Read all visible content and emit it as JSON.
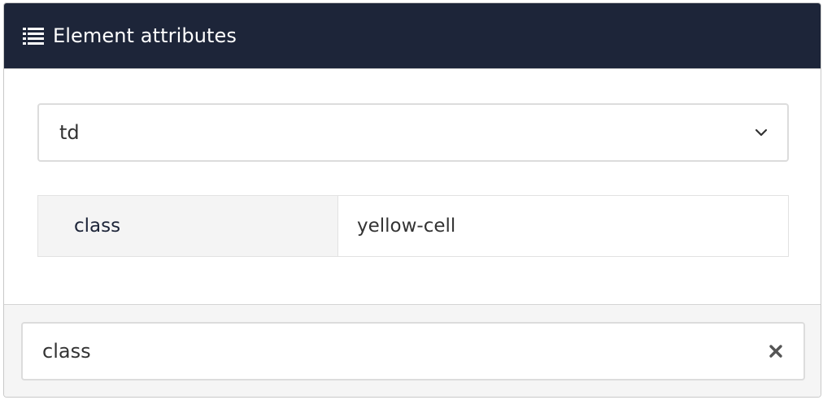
{
  "header": {
    "title": "Element attributes",
    "icon": "list-icon"
  },
  "element_select": {
    "selected": "td",
    "icon": "chevron-down-icon"
  },
  "attributes": [
    {
      "name": "class",
      "value": "yellow-cell"
    }
  ],
  "filter": {
    "value": "class",
    "clear_icon": "close-icon"
  },
  "colors": {
    "header_bg": "#1d2539",
    "name_cell_bg": "#f4f4f4",
    "footer_bg": "#f5f5f5"
  }
}
